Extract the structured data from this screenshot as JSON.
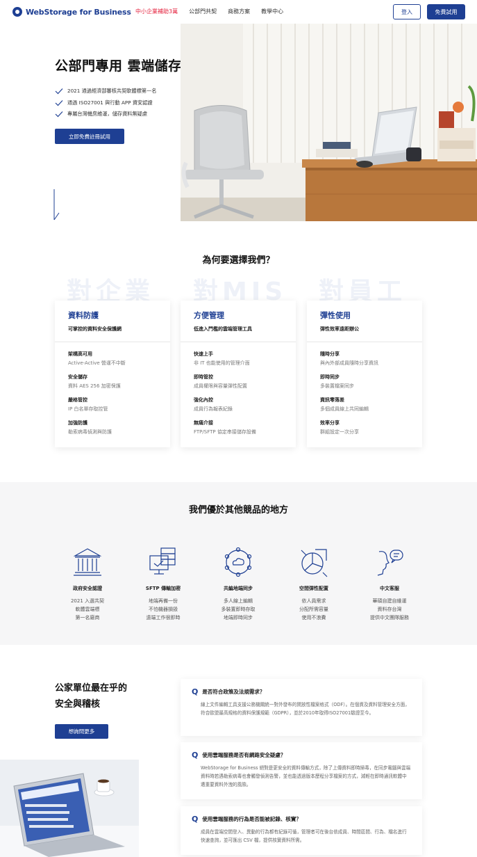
{
  "nav": {
    "logo_text": "WebStorage for Business",
    "links": [
      "中小企業補助3萬",
      "公部門共契",
      "商務方案",
      "教學中心"
    ],
    "login": "登入",
    "free_trial": "免費試用"
  },
  "hero": {
    "title": "公部門專用 雲端儲存服務",
    "bullets": [
      "2021 通過經濟部審核共契軟體標第一名",
      "通過 ISO27001 與行動 APP 資安認證",
      "專屬台灣機房維運，儲存資料無疑慮"
    ],
    "cta": "立即免費註冊試用"
  },
  "why": {
    "title": "為何要選擇我們？",
    "ghost": [
      "對企業",
      "對MIS",
      "對員工"
    ],
    "cards": [
      {
        "title": "資料防護",
        "sub": "可掌控的資料安全保護網",
        "features": [
          {
            "t": "架構高可用",
            "d": "Active-Active 營運不中斷"
          },
          {
            "t": "安全儲存",
            "d": "資料 AES 256 加密保護"
          },
          {
            "t": "嚴格管控",
            "d": "IP 白名單存取控管"
          },
          {
            "t": "加強防護",
            "d": "勒索病毒偵測與防護"
          }
        ]
      },
      {
        "title": "方便管理",
        "sub": "低進入門檻的雲端管理工具",
        "features": [
          {
            "t": "快速上手",
            "d": "非 IT 也能使用的管理介面"
          },
          {
            "t": "即時管控",
            "d": "成員權限與容量彈性配置"
          },
          {
            "t": "強化內控",
            "d": "成員行為報表紀錄"
          },
          {
            "t": "無痛介接",
            "d": "FTP/SFTP 協定串接儲存設備"
          }
        ]
      },
      {
        "title": "彈性使用",
        "sub": "彈性效率遠距辦公",
        "features": [
          {
            "t": "隨時分享",
            "d": "與內外部成員隨時分享資訊"
          },
          {
            "t": "即時同步",
            "d": "多裝置檔案同步"
          },
          {
            "t": "資訊零落差",
            "d": "多個成員線上共同編輯"
          },
          {
            "t": "效率分享",
            "d": "群組設定一次分享"
          }
        ]
      }
    ]
  },
  "advantages": {
    "title": "我們優於其他競品的地方",
    "items": [
      {
        "icon": "government-building-icon",
        "name": "政府安全認證",
        "desc": [
          "2021 入選共契",
          "軟體雲端標",
          "第一名廠商"
        ]
      },
      {
        "icon": "server-secure-icon",
        "name": "SFTP 傳輸加密",
        "desc": [
          "地端再備一份",
          "不怕機器損毀",
          "遠端工作很即時"
        ]
      },
      {
        "icon": "cloud-sync-icon",
        "name": "共編地端同步",
        "desc": [
          "多人線上編輯",
          "多裝置即時存取",
          "地端即時同步"
        ]
      },
      {
        "icon": "pie-chart-icon",
        "name": "空間彈性配置",
        "desc": [
          "依人員需求",
          "分配所需容量",
          "使用不浪費"
        ]
      },
      {
        "icon": "customer-service-icon",
        "name": "中文客服",
        "desc": [
          "華碩自建自維運",
          "資料存台灣",
          "提供中文團隊服務"
        ]
      }
    ]
  },
  "compliance": {
    "title_line1": "公家單位最在乎的",
    "title_line2": "安全與稽核",
    "cta": "想詢問更多",
    "faqs": [
      {
        "mark": "Q",
        "q": "是否符合政策及法規需求？",
        "a": "線上文件編輯工具支援公務機關統一對外發布的開放性檔案格式（ODF）。在個資及資料管理安全方面，符合歐盟最高規格的資料保護規範（GDPR），並於2010年取得ISO27001驗證至今。"
      },
      {
        "mark": "Q",
        "q": "使用雲端服務是否有網路安全疑慮？",
        "a": "WebStorage for Business 絕對是更安全的資料傳輸方式，除了上傳資料即時掃毒，在同步電腦與雲端資料時若遇勒索病毒也會觸發偵測告警，並也能透過版本歷程分享檔案的方式，減輕在即時通訊軟體中遭重要資料外洩的風險。"
      },
      {
        "mark": "Q",
        "q": "使用雲端服務的行為是否能被記錄、核實？",
        "a": "成員在雲端空間登入、異動的行為都有紀錄可循，管理者可在後台依成員、時間區間、行為、檔名進行快速查詢，並可匯出 CSV 檔，提供核實資料所需。"
      }
    ]
  },
  "colors": {
    "brand": "#1e3f93",
    "nav_highlight": "#e4203c",
    "band": "#f6f6f7"
  }
}
